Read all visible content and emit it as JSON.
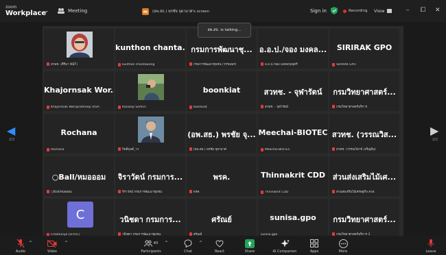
{
  "app": {
    "brand_top": "zoom",
    "brand_name": "Workplace"
  },
  "topbar": {
    "meeting_label": "Meeting",
    "share_badge": "m",
    "share_label": "(อพ.สธ.) พรชัย จุดามาศ's screen",
    "signin": "Sign in",
    "recording": "Recording",
    "view": "View",
    "window_controls": [
      "–",
      "⧠",
      "✕"
    ]
  },
  "talking": "อพ.สธ. is talking...",
  "pager": {
    "left": "2/3",
    "right": "2/2"
  },
  "tiles": [
    {
      "name": "",
      "caption": "สวพช. (ศิริมา NBT)",
      "photo": "woman"
    },
    {
      "name": "kunthon  chanta...",
      "caption": "kunthon chantawong"
    },
    {
      "name": "กรมการพัฒนาชุ...",
      "caption": "กรมการพัฒนาชุมชน (วรรณพร)"
    },
    {
      "name": "อ.อ.ป./จอง มงคล...",
      "caption": "อ.อ.ป./จอง มงคลกุลบุตรี"
    },
    {
      "name": "SIRIRAK GPO",
      "caption": "SIRIRAK GPO"
    },
    {
      "name": "Khajornsak  Wor...",
      "caption": "Khajornsak Worapratheep (RSP..."
    },
    {
      "name": "",
      "caption": "Kanokip Somsri",
      "photo": "man-outdoor"
    },
    {
      "name": "boonkiat",
      "caption": "boonkiat"
    },
    {
      "name": "สวทช. - จุฬารัตน์",
      "caption": "สวทช. - จุฬารัตน์"
    },
    {
      "name": "กรมวิทยาศาสตร์...",
      "caption": "กรมวิทยาศาสตร์บริการ"
    },
    {
      "name": "Rochana",
      "caption": "Rochana"
    },
    {
      "name": "",
      "caption": "กิตติกุลดี_วว",
      "photo": "man-suit"
    },
    {
      "name": "(อพ.สธ.) พรชัย จุ...",
      "caption": "(อพ.สธ.) พรชัย จุดามาศ"
    },
    {
      "name": "Meechai-BIOTEC",
      "caption": "Meechai-BIOTEC"
    },
    {
      "name": "สวทช. (วรรณวิส...",
      "caption": "สวทช. (วรรณวิสาข์ เจริญลิม)"
    },
    {
      "name": "○Ball/หมอออม",
      "caption": "○Ball/หมอออม"
    },
    {
      "name": "จิราวัตน์ กรมการ...",
      "caption": "จิราวัตน์ กรมการพัฒนาชุมชน"
    },
    {
      "name": "พรค.",
      "caption": "พรค."
    },
    {
      "name": "Thinnakrit CDD",
      "caption": "Thinnakrit CDD"
    },
    {
      "name": "ส่วนส่งเสริมไม้เศ...",
      "caption": "ส่วนส่งเสริมไม้เศรษฐกิจ สวส."
    },
    {
      "name": "",
      "caption": "Chamunya (D.P.O.)",
      "avatar": "C"
    },
    {
      "name": "วนิชดา กรมการ...",
      "caption": "วนิชดา กรมการพัฒนาชุมชน"
    },
    {
      "name": "ศรัณย์",
      "caption": "ศรัณย์"
    },
    {
      "name": "sunisa.gpo",
      "caption": "sunisa.gpo",
      "nomic": true
    },
    {
      "name": "กรมวิทยาศาสตร์...",
      "caption": "กรมวิทยาศาสตร์บริการ 2"
    }
  ],
  "toolbar": {
    "audio": "Audio",
    "video": "Video",
    "participants": "Participants",
    "participant_count": "40",
    "chat": "Chat",
    "react": "React",
    "share": "Share",
    "ai": "AI Companion",
    "apps": "Apps",
    "more": "More",
    "leave": "Leave"
  },
  "colors": {
    "accent": "#0b5cff",
    "share_green": "#23a45a",
    "mute_red": "#e23b3b"
  }
}
